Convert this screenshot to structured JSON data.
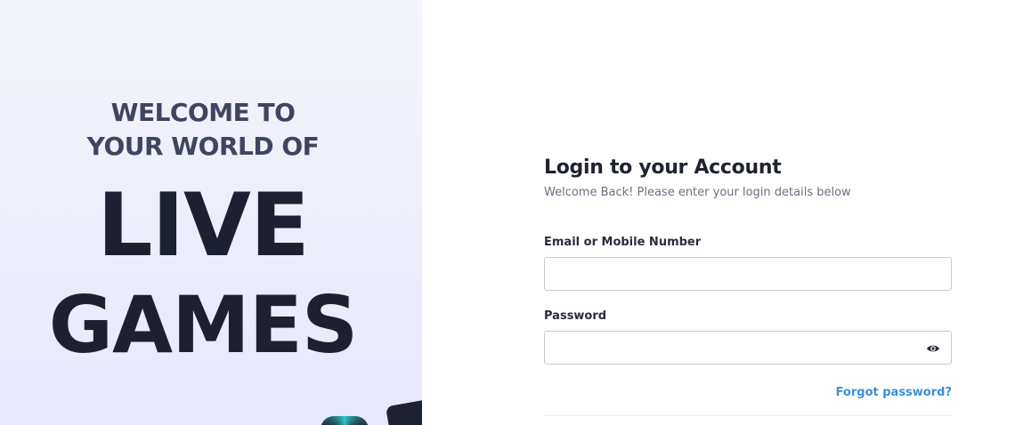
{
  "hero": {
    "subtitle_line1": "WELCOME TO",
    "subtitle_line2": "YOUR WORLD OF",
    "title_line1": "LIVE",
    "title_line2": "GAMES"
  },
  "login": {
    "title": "Login to your Account",
    "subtitle": "Welcome Back! Please enter your login details below",
    "email_label": "Email or Mobile Number",
    "email_value": "",
    "password_label": "Password",
    "password_value": "",
    "password_toggle_icon": "eye-icon",
    "forgot_label": "Forgot password?"
  },
  "colors": {
    "hero_background": "#eceefb",
    "hero_text_dark": "#1d2030",
    "hero_text_sub": "#3f4461",
    "link": "#3b8fd6",
    "input_border": "#c9cad2"
  }
}
